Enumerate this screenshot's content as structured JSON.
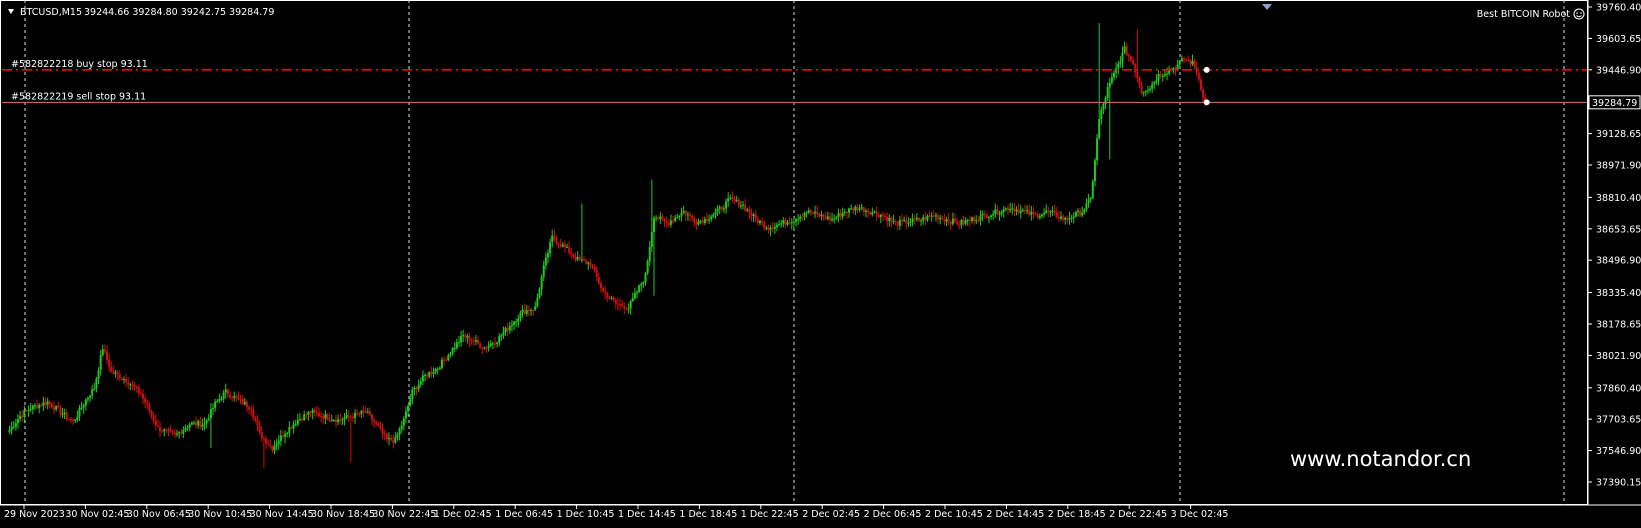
{
  "chart_data": {
    "type": "candlestick",
    "symbol_header": "BTCUSD,M15",
    "ohlc_header": "39244.66 39284.80 39242.75 39284.79",
    "robot_label": "Best BITCOIN Robot",
    "current_price": "39284.79",
    "ylim": [
      37390.15,
      39760.4
    ],
    "y_ticks": [
      "39760.40",
      "39603.65",
      "39446.90",
      "39284.79",
      "39128.65",
      "38971.90",
      "38810.40",
      "38653.65",
      "38496.90",
      "38335.40",
      "38178.65",
      "38021.90",
      "37860.40",
      "37703.65",
      "37546.90",
      "37390.15"
    ],
    "x_ticks": [
      "29 Nov 2023",
      "30 Nov 02:45",
      "30 Nov 06:45",
      "30 Nov 10:45",
      "30 Nov 14:45",
      "30 Nov 18:45",
      "30 Nov 22:45",
      "1 Dec 02:45",
      "1 Dec 06:45",
      "1 Dec 10:45",
      "1 Dec 14:45",
      "1 Dec 18:45",
      "1 Dec 22:45",
      "2 Dec 02:45",
      "2 Dec 06:45",
      "2 Dec 10:45",
      "2 Dec 14:45",
      "2 Dec 18:45",
      "2 Dec 22:45",
      "3 Dec 02:45"
    ],
    "orders": [
      {
        "label": "#582822218 buy stop 93.11",
        "price": 39446.9,
        "style": "dashdot",
        "color": "#e01010"
      },
      {
        "label": "#582822219 sell stop 93.11",
        "price": 39284.79,
        "style": "solid",
        "color": "#e07070"
      }
    ],
    "bull_color": "#22c822",
    "bear_color": "#d01010",
    "anchors": [
      [
        0,
        37650
      ],
      [
        5,
        37720
      ],
      [
        10,
        37760
      ],
      [
        18,
        37790
      ],
      [
        24,
        37740
      ],
      [
        30,
        37690
      ],
      [
        36,
        37800
      ],
      [
        40,
        37860
      ],
      [
        44,
        38060
      ],
      [
        48,
        37940
      ],
      [
        55,
        37900
      ],
      [
        62,
        37830
      ],
      [
        70,
        37660
      ],
      [
        78,
        37620
      ],
      [
        85,
        37680
      ],
      [
        92,
        37680
      ],
      [
        97,
        37780
      ],
      [
        102,
        37840
      ],
      [
        108,
        37800
      ],
      [
        114,
        37760
      ],
      [
        118,
        37630
      ],
      [
        124,
        37560
      ],
      [
        130,
        37640
      ],
      [
        136,
        37700
      ],
      [
        142,
        37740
      ],
      [
        148,
        37720
      ],
      [
        155,
        37700
      ],
      [
        162,
        37720
      ],
      [
        168,
        37740
      ],
      [
        172,
        37690
      ],
      [
        178,
        37600
      ],
      [
        182,
        37600
      ],
      [
        186,
        37700
      ],
      [
        190,
        37840
      ],
      [
        196,
        37920
      ],
      [
        202,
        37960
      ],
      [
        208,
        38040
      ],
      [
        214,
        38120
      ],
      [
        218,
        38100
      ],
      [
        224,
        38060
      ],
      [
        230,
        38100
      ],
      [
        236,
        38170
      ],
      [
        242,
        38240
      ],
      [
        248,
        38260
      ],
      [
        252,
        38460
      ],
      [
        256,
        38610
      ],
      [
        262,
        38560
      ],
      [
        268,
        38500
      ],
      [
        274,
        38480
      ],
      [
        280,
        38340
      ],
      [
        286,
        38280
      ],
      [
        292,
        38260
      ],
      [
        296,
        38340
      ],
      [
        300,
        38420
      ],
      [
        304,
        38720
      ],
      [
        310,
        38680
      ],
      [
        318,
        38740
      ],
      [
        324,
        38690
      ],
      [
        328,
        38700
      ],
      [
        334,
        38740
      ],
      [
        340,
        38800
      ],
      [
        346,
        38770
      ],
      [
        352,
        38700
      ],
      [
        358,
        38660
      ],
      [
        364,
        38680
      ],
      [
        370,
        38700
      ],
      [
        376,
        38740
      ],
      [
        382,
        38720
      ],
      [
        388,
        38700
      ],
      [
        394,
        38740
      ],
      [
        400,
        38760
      ],
      [
        406,
        38740
      ],
      [
        412,
        38720
      ],
      [
        418,
        38680
      ],
      [
        424,
        38690
      ],
      [
        430,
        38700
      ],
      [
        436,
        38720
      ],
      [
        442,
        38700
      ],
      [
        448,
        38680
      ],
      [
        454,
        38700
      ],
      [
        460,
        38720
      ],
      [
        466,
        38740
      ],
      [
        472,
        38760
      ],
      [
        478,
        38740
      ],
      [
        484,
        38720
      ],
      [
        490,
        38740
      ],
      [
        494,
        38720
      ],
      [
        498,
        38700
      ],
      [
        502,
        38720
      ],
      [
        506,
        38740
      ],
      [
        510,
        38800
      ],
      [
        514,
        39200
      ],
      [
        518,
        39350
      ],
      [
        522,
        39450
      ],
      [
        526,
        39550
      ],
      [
        530,
        39480
      ],
      [
        534,
        39340
      ],
      [
        538,
        39360
      ],
      [
        542,
        39420
      ],
      [
        546,
        39440
      ],
      [
        550,
        39460
      ],
      [
        554,
        39500
      ],
      [
        558,
        39480
      ],
      [
        560,
        39440
      ],
      [
        562,
        39360
      ],
      [
        564,
        39284
      ]
    ],
    "spikes": [
      [
        514,
        39680
      ],
      [
        514,
        39200
      ],
      [
        519,
        39000
      ],
      [
        532,
        39650
      ],
      [
        270,
        38780
      ],
      [
        303,
        38900
      ],
      [
        304,
        38320
      ],
      [
        120,
        37460
      ],
      [
        161,
        37490
      ],
      [
        95,
        37560
      ]
    ]
  }
}
